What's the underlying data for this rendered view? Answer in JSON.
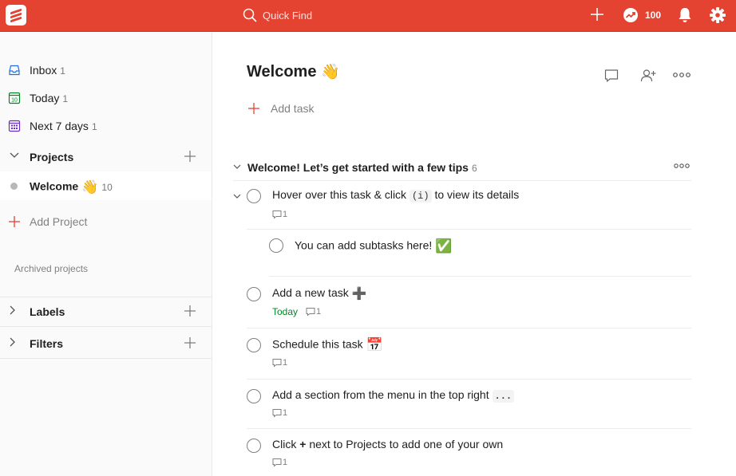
{
  "topbar": {
    "search_placeholder": "Quick Find",
    "karma": "100",
    "accent": "#e44332"
  },
  "sidebar": {
    "items": [
      {
        "label": "Inbox",
        "count": "1",
        "icon": "inbox-icon"
      },
      {
        "label": "Today",
        "count": "1",
        "icon": "calendar-today-icon"
      },
      {
        "label": "Next 7 days",
        "count": "1",
        "icon": "calendar-week-icon"
      }
    ],
    "projects_label": "Projects",
    "projects": [
      {
        "label": "Welcome",
        "emoji": "👋",
        "count": "10"
      }
    ],
    "add_project": "Add Project",
    "archived": "Archived projects",
    "labels_label": "Labels",
    "filters_label": "Filters"
  },
  "main": {
    "title": "Welcome",
    "title_emoji": "👋",
    "add_task": "Add task",
    "section": {
      "title": "Welcome! Let’s get started with a few tips",
      "count": "6"
    },
    "tasks": [
      {
        "before": "Hover over this task & click",
        "code": "(i)",
        "after": "to view its details",
        "comments": "1"
      },
      {
        "text": "You can add subtasks here!",
        "emoji": "✅"
      },
      {
        "text": "Add a new task",
        "emoji": "➕",
        "date": "Today",
        "comments": "1"
      },
      {
        "text": "Schedule this task",
        "emoji": "📅",
        "comments": "1"
      },
      {
        "text": "Add a section from the menu in the top right",
        "code": "...",
        "comments": "1"
      },
      {
        "before": "Click",
        "bold": "+",
        "after": "next to Projects to add one of your own",
        "comments": "1"
      }
    ]
  }
}
